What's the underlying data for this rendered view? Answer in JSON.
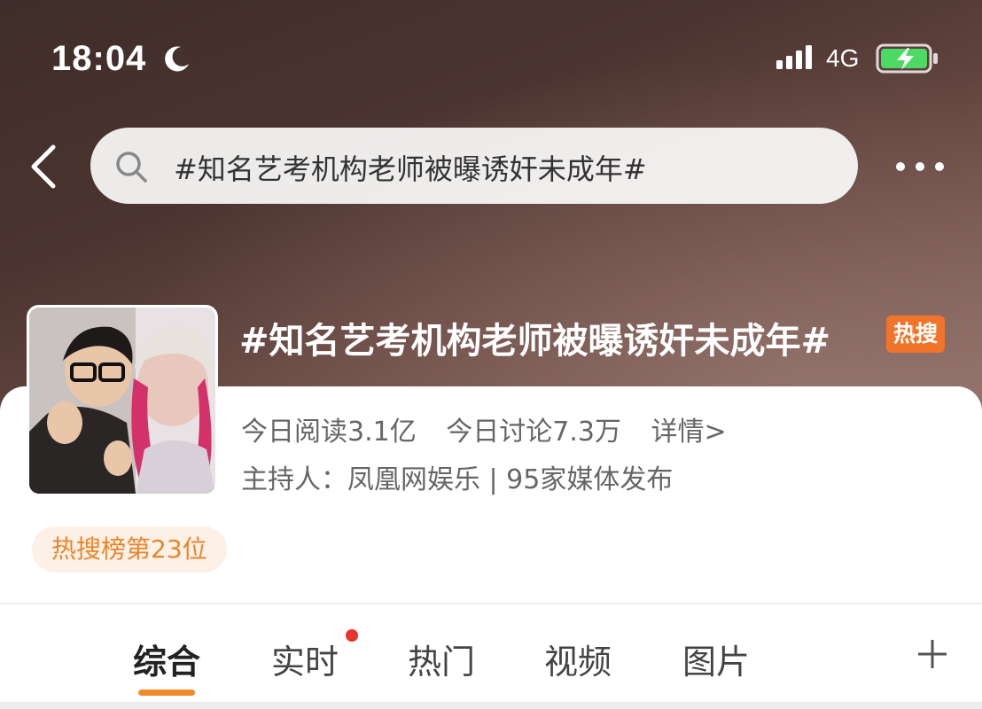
{
  "status_bar": {
    "time": "18:04",
    "network": "4G",
    "icons": [
      "moon-icon",
      "signal-icon",
      "battery-charging-icon"
    ]
  },
  "nav": {
    "back_icon": "back-chevron-icon",
    "search_query": "#知名艺考机构老师被曝诱奸未成年#",
    "more_icon": "more-dots-icon"
  },
  "topic": {
    "title": "#知名艺考机构老师被曝诱奸未成年#",
    "badge": "热搜",
    "stats": {
      "reads": "今日阅读3.1亿",
      "discussions": "今日讨论7.3万",
      "details": "详情>"
    },
    "host_line": "主持人：凤凰网娱乐 | 95家媒体发布",
    "rank": "热搜榜第23位"
  },
  "tabs": {
    "items": [
      {
        "label": "综合",
        "active": true
      },
      {
        "label": "实时",
        "active": false,
        "has_dot": true
      },
      {
        "label": "热门",
        "active": false
      },
      {
        "label": "视频",
        "active": false
      },
      {
        "label": "图片",
        "active": false
      }
    ],
    "add_icon": "plus-icon"
  },
  "colors": {
    "accent": "#f18a2a",
    "hot_badge": "#f2742a",
    "notification_dot": "#e8332e",
    "rank_text": "#e8862e"
  }
}
